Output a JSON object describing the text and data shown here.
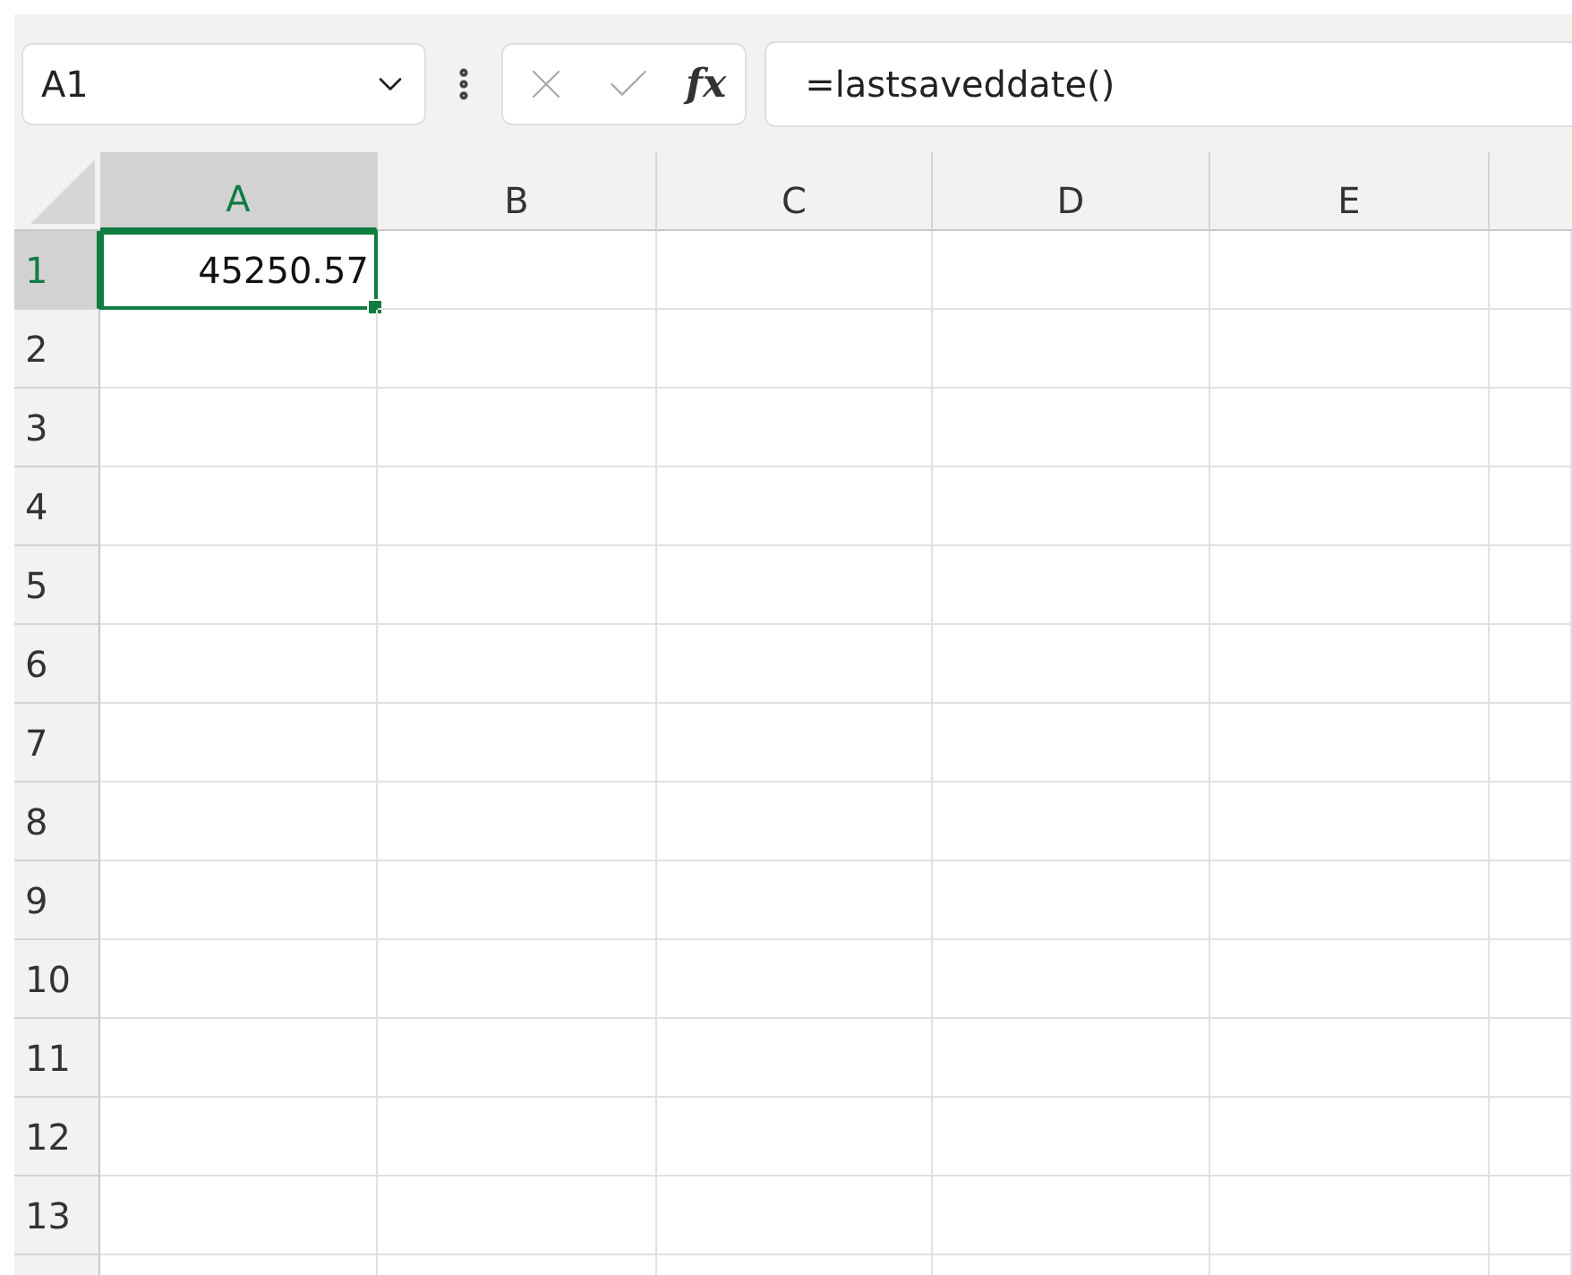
{
  "name_box": {
    "value": "A1"
  },
  "formula_bar": {
    "function_label": "fx",
    "value": "=lastsaveddate()"
  },
  "columns": [
    {
      "label": "A",
      "selected": true
    },
    {
      "label": "B",
      "selected": false
    },
    {
      "label": "C",
      "selected": false
    },
    {
      "label": "D",
      "selected": false
    },
    {
      "label": "E",
      "selected": false
    }
  ],
  "rows": [
    {
      "label": "1",
      "selected": true,
      "cells": [
        "45250.57"
      ]
    },
    {
      "label": "2",
      "selected": false
    },
    {
      "label": "3",
      "selected": false
    },
    {
      "label": "4",
      "selected": false
    },
    {
      "label": "5",
      "selected": false
    },
    {
      "label": "6",
      "selected": false
    },
    {
      "label": "7",
      "selected": false
    },
    {
      "label": "8",
      "selected": false
    },
    {
      "label": "9",
      "selected": false
    },
    {
      "label": "10",
      "selected": false
    },
    {
      "label": "11",
      "selected": false
    },
    {
      "label": "12",
      "selected": false
    },
    {
      "label": "13",
      "selected": false
    }
  ]
}
